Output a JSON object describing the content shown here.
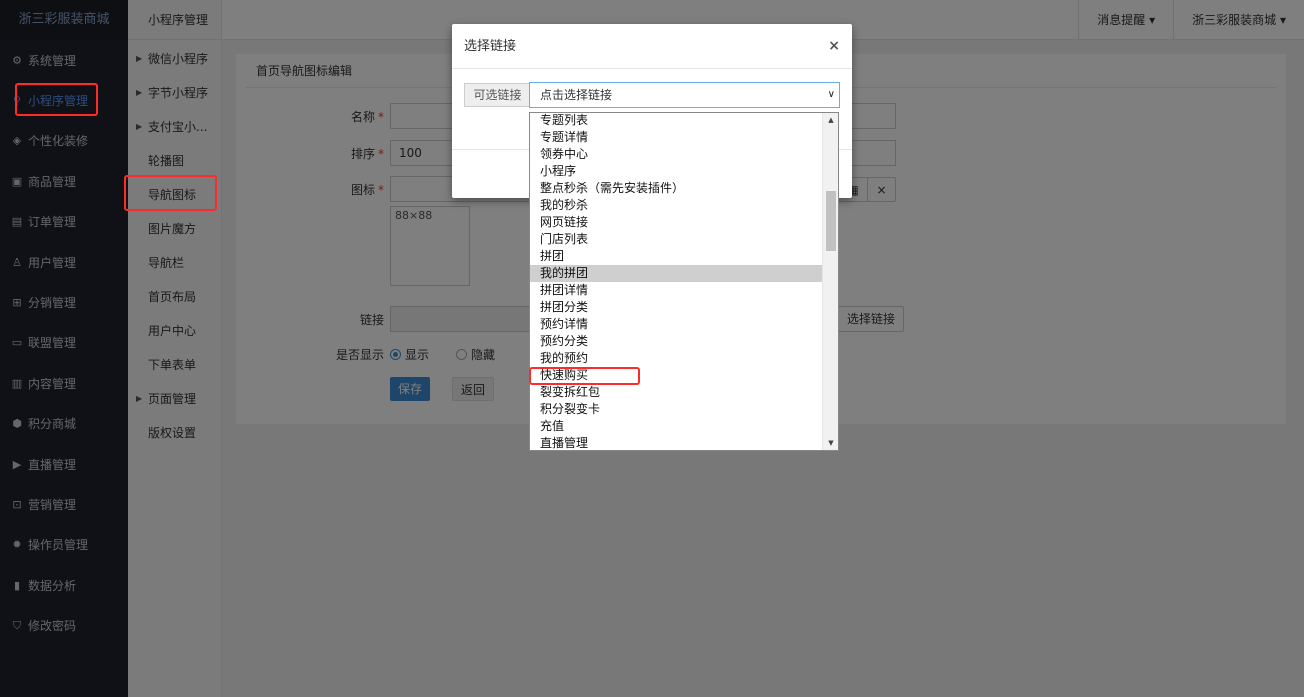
{
  "sidebar": {
    "brand": "浙三彩服装商城",
    "items": [
      {
        "label": "系统管理",
        "icon": "gear-icon"
      },
      {
        "label": "小程序管理",
        "icon": "link-icon"
      },
      {
        "label": "个性化装修",
        "icon": "diamond-icon"
      },
      {
        "label": "商品管理",
        "icon": "box-icon"
      },
      {
        "label": "订单管理",
        "icon": "clipboard-icon"
      },
      {
        "label": "用户管理",
        "icon": "user-icon"
      },
      {
        "label": "分销管理",
        "icon": "sitemap-icon"
      },
      {
        "label": "联盟管理",
        "icon": "store-icon"
      },
      {
        "label": "内容管理",
        "icon": "newspaper-icon"
      },
      {
        "label": "积分商城",
        "icon": "cube-icon"
      },
      {
        "label": "直播管理",
        "icon": "play-icon"
      },
      {
        "label": "营销管理",
        "icon": "gift-icon"
      },
      {
        "label": "操作员管理",
        "icon": "cog-icon"
      },
      {
        "label": "数据分析",
        "icon": "bar-chart-icon"
      },
      {
        "label": "修改密码",
        "icon": "shield-icon"
      }
    ]
  },
  "subnav": {
    "title": "小程序管理",
    "items": [
      {
        "label": "微信小程序",
        "caret": true
      },
      {
        "label": "字节小程序",
        "caret": true
      },
      {
        "label": "支付宝小...",
        "caret": true
      },
      {
        "label": "轮播图",
        "caret": false
      },
      {
        "label": "导航图标",
        "caret": false
      },
      {
        "label": "图片魔方",
        "caret": false
      },
      {
        "label": "导航栏",
        "caret": false
      },
      {
        "label": "首页布局",
        "caret": false
      },
      {
        "label": "用户中心",
        "caret": false
      },
      {
        "label": "下单表单",
        "caret": false
      },
      {
        "label": "页面管理",
        "caret": true
      },
      {
        "label": "版权设置",
        "caret": false
      }
    ]
  },
  "topbar": {
    "notify": "消息提醒",
    "store": "浙三彩服装商城"
  },
  "form": {
    "title": "首页导航图标编辑",
    "name_label": "名称",
    "sort_label": "排序",
    "sort_value": "100",
    "icon_label": "图标",
    "icon_size": "88×88",
    "link_label": "链接",
    "choose_link_btn": "选择链接",
    "show_label": "是否显示",
    "show_on": "显示",
    "show_off": "隐藏",
    "save": "保存",
    "back": "返回",
    "clear_icon": "×"
  },
  "modal": {
    "title": "选择链接",
    "close": "×",
    "addon": "可选链接",
    "select_value": "点击选择链接",
    "options": [
      "专题列表",
      "专题详情",
      "领券中心",
      "小程序",
      "整点秒杀（需先安装插件）",
      "我的秒杀",
      "网页链接",
      "门店列表",
      "拼团",
      "我的拼团",
      "拼团详情",
      "拼团分类",
      "预约详情",
      "预约分类",
      "我的预约",
      "快速购买",
      "裂变拆红包",
      "积分裂变卡",
      "充值",
      "直播管理"
    ],
    "hovered_option": "我的拼团"
  },
  "colors": {
    "sidebar_bg": "#20222c",
    "active": "#5b9bff",
    "highlight_box": "#ff2a2a",
    "primary": "#3c8dd6"
  }
}
